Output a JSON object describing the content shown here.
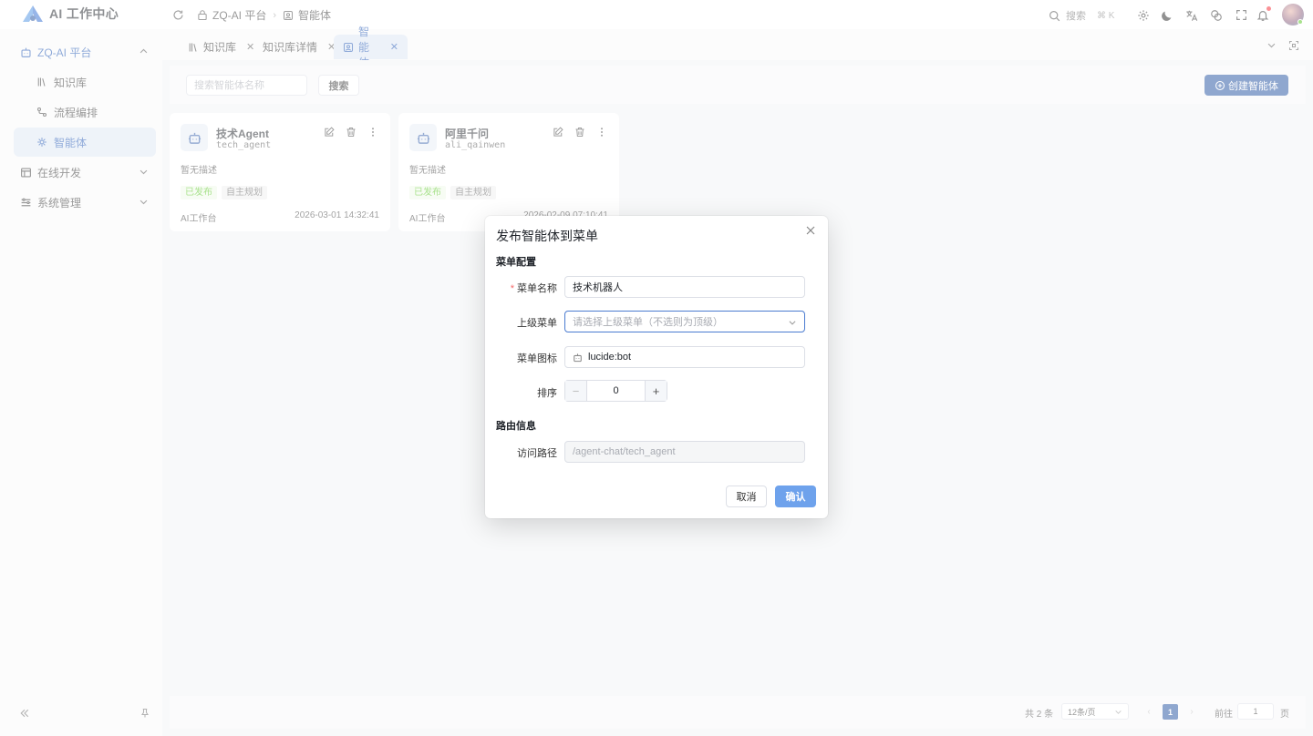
{
  "app": {
    "title": "AI 工作中心",
    "colors": {
      "brand": "#1f4e9e",
      "accent": "#2e6ad1",
      "active_bg": "#dde6f3"
    }
  },
  "breadcrumb": {
    "items": [
      "ZQ-AI 平台",
      "智能体"
    ]
  },
  "header": {
    "search_label": "搜索",
    "search_kbd": "⌘ K",
    "icons": [
      "settings-icon",
      "moon-icon",
      "translate-icon",
      "palette-icon",
      "fullscreen-icon",
      "bell-icon"
    ]
  },
  "sidebar": {
    "groups": [
      {
        "label": "ZQ-AI 平台",
        "items": [
          {
            "label": "知识库"
          },
          {
            "label": "流程编排"
          },
          {
            "label": "智能体"
          }
        ]
      },
      {
        "label": "在线开发"
      },
      {
        "label": "系统管理"
      }
    ]
  },
  "tabs": [
    {
      "label": "知识库"
    },
    {
      "label": "知识库详情"
    },
    {
      "label": "智能体"
    }
  ],
  "toolbar": {
    "search_placeholder": "搜索智能体名称",
    "search_button": "搜索",
    "create_button": "创建智能体"
  },
  "cards": [
    {
      "name": "技术Agent",
      "code": "tech_agent",
      "desc": "暂无描述",
      "tags": [
        "已发布",
        "自主规划"
      ],
      "platform": "AI工作台",
      "time": "2026-03-01 14:32:41"
    },
    {
      "name": "阿里千问",
      "code": "ali_qainwen",
      "desc": "暂无描述",
      "tags": [
        "已发布",
        "自主规划"
      ],
      "platform": "AI工作台",
      "time": "2026-02-09 07:10:41"
    }
  ],
  "pagination": {
    "total": "共 2 条",
    "page_size": "12条/页",
    "current": "1",
    "goto_label": "前往",
    "goto_value": "1",
    "page_suffix": "页"
  },
  "dialog": {
    "title": "发布智能体到菜单",
    "section_menu": "菜单配置",
    "menu_name_label": "菜单名称",
    "menu_name_value": "技术机器人",
    "parent_label": "上级菜单",
    "parent_placeholder": "请选择上级菜单（不选则为顶级）",
    "icon_label": "菜单图标",
    "icon_value": "lucide:bot",
    "order_label": "排序",
    "order_value": "0",
    "section_route": "路由信息",
    "path_label": "访问路径",
    "path_value": "/agent-chat/tech_agent",
    "cancel": "取消",
    "confirm": "确认"
  }
}
